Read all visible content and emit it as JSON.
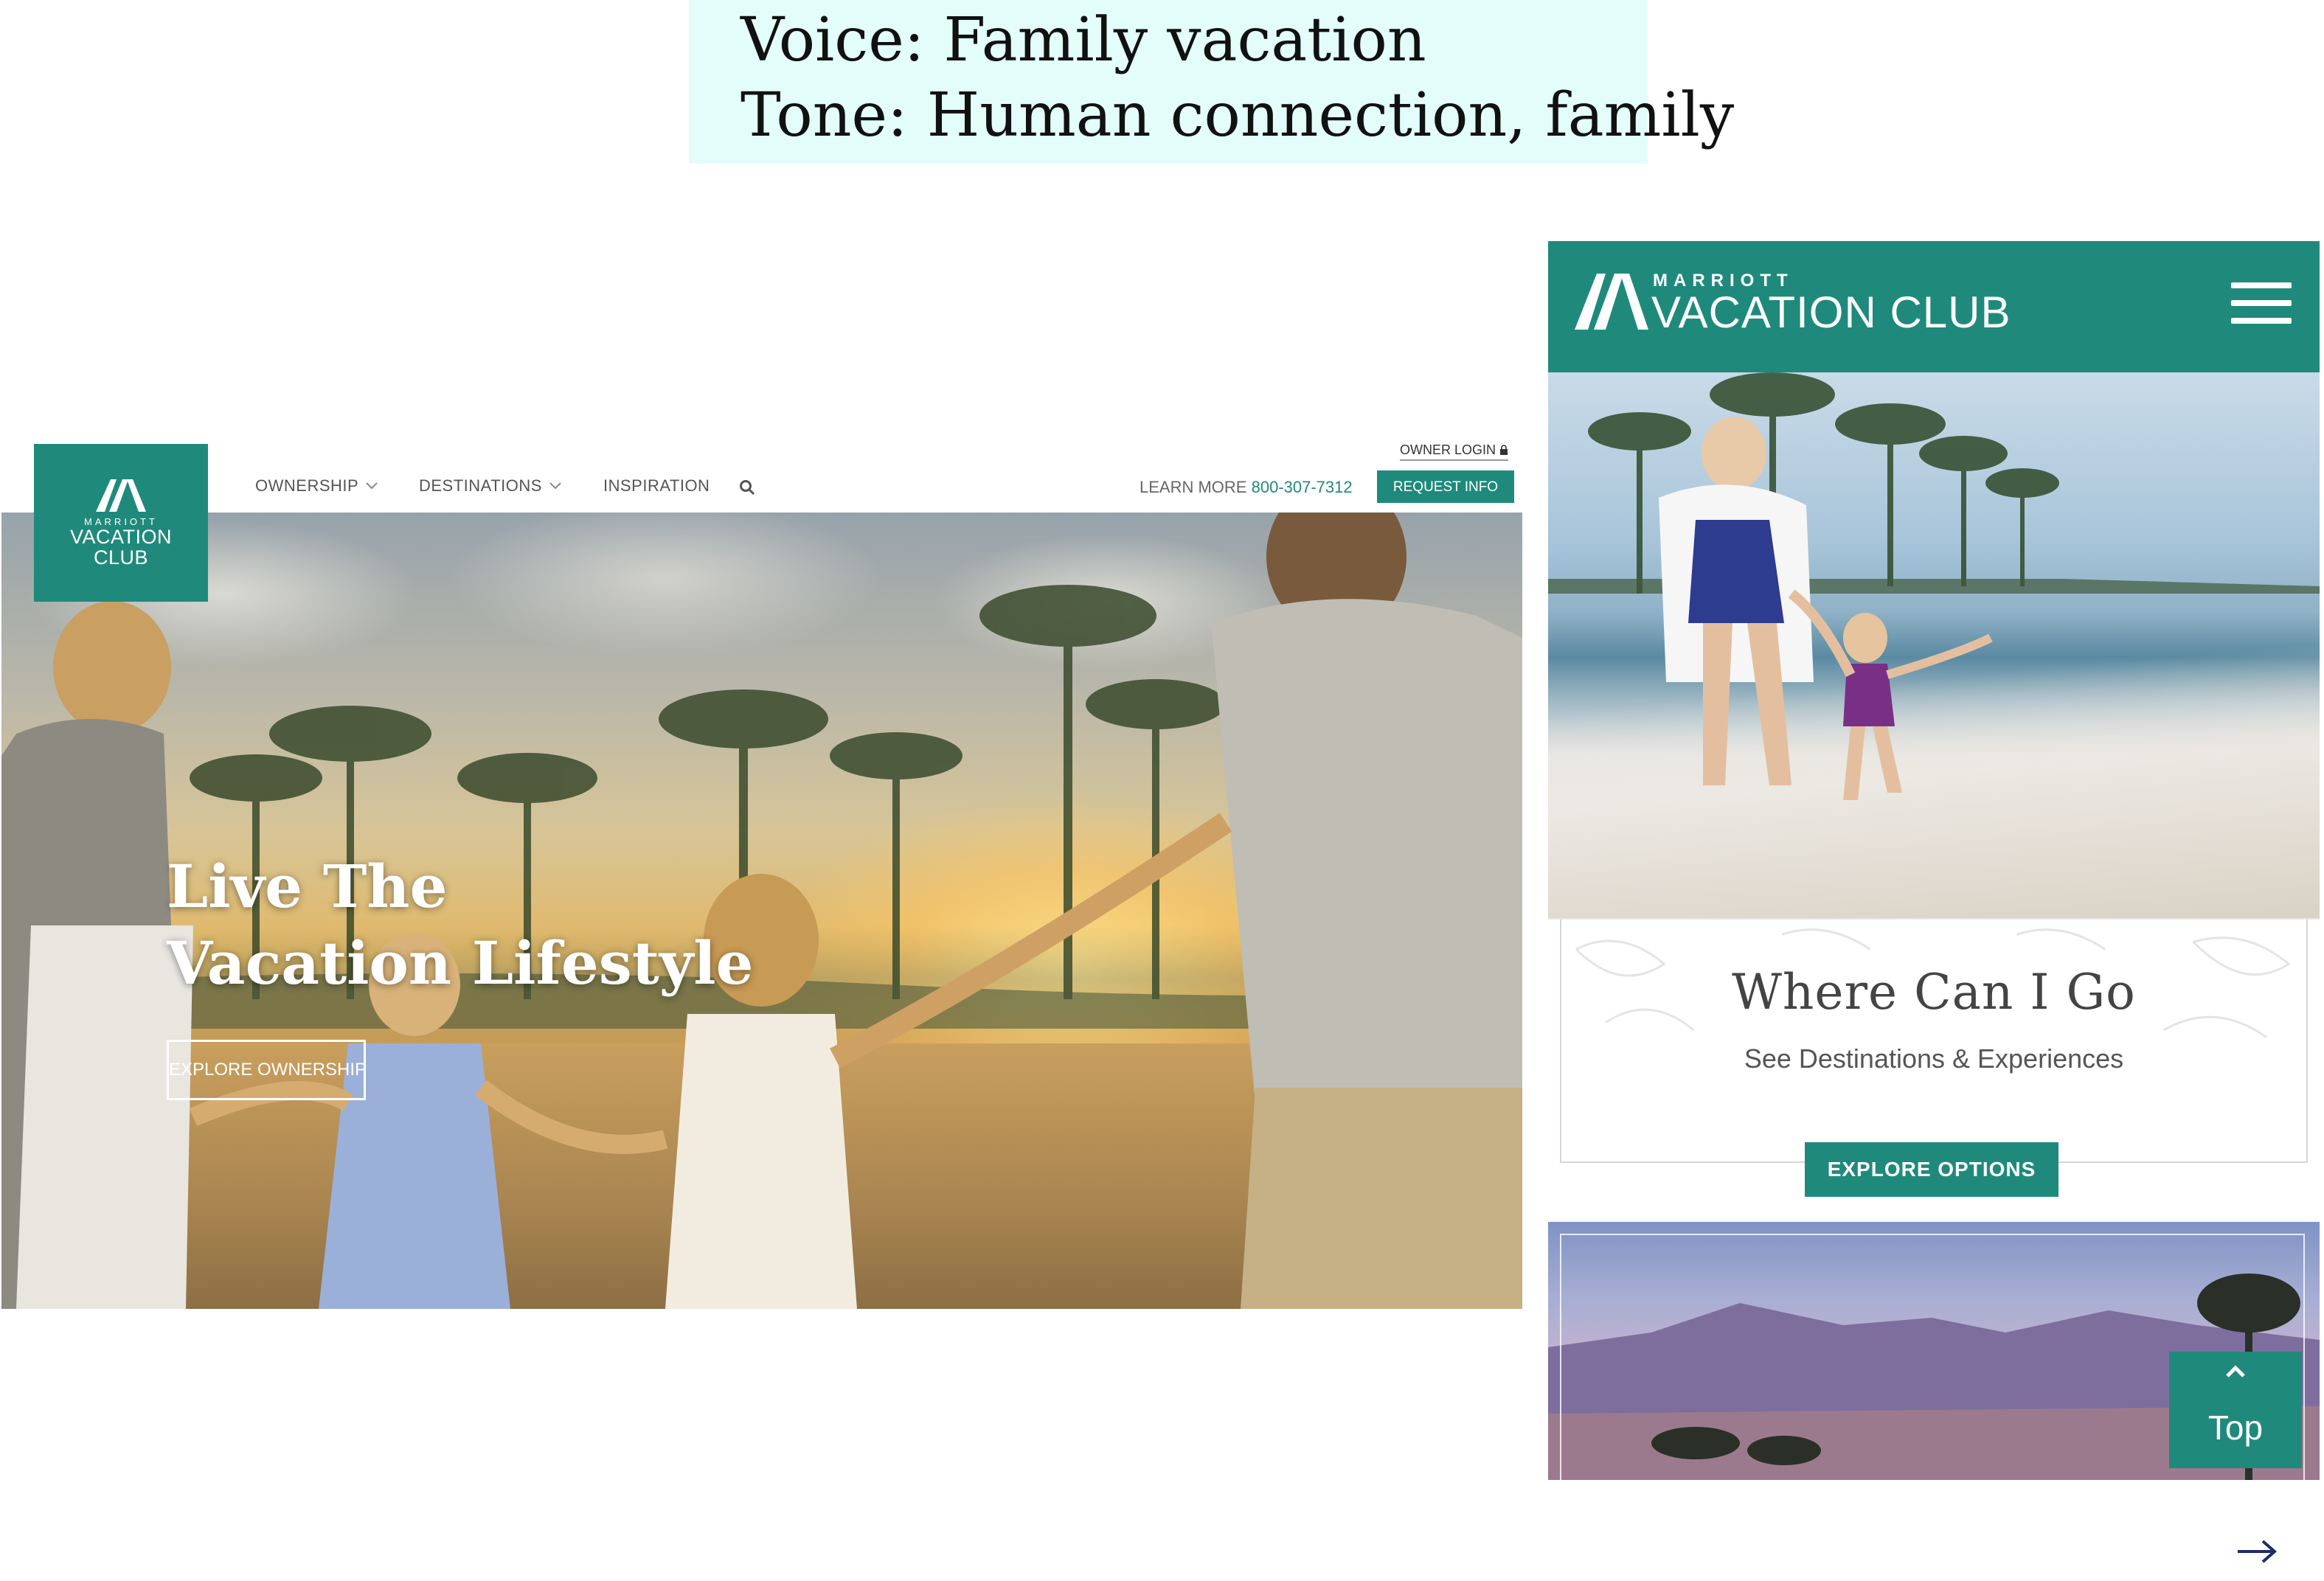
{
  "annotation": {
    "line1": "Voice: Family vacation",
    "line2": "Tone: Human connection, family"
  },
  "desktop": {
    "logo": {
      "small": "MARRIOTT",
      "big_line1": "VACATION",
      "big_line2": "CLUB"
    },
    "nav": [
      {
        "label": "OWNERSHIP",
        "has_dropdown": true
      },
      {
        "label": "DESTINATIONS",
        "has_dropdown": true
      },
      {
        "label": "INSPIRATION",
        "has_dropdown": false
      }
    ],
    "owner_login": "OWNER LOGIN",
    "learn_more": "LEARN MORE",
    "phone": "800-307-7312",
    "request_info": "REQUEST INFO",
    "hero": {
      "headline_line1": "Live The",
      "headline_line2": "Vacation Lifestyle",
      "cta": "EXPLORE OWNERSHIP"
    }
  },
  "mobile": {
    "logo": {
      "small": "MARRIOTT",
      "big": "VACATION CLUB"
    },
    "card": {
      "title": "Where Can I Go",
      "subtitle": "See Destinations & Experiences",
      "cta": "EXPLORE OPTIONS"
    },
    "top_button": "Top"
  },
  "colors": {
    "brand_teal": "#1f8a7c",
    "annotation_bg": "#e2fdfa",
    "arrow": "#1f2a6b"
  },
  "icons": [
    "marriott-m-logo-icon",
    "chevron-down-icon",
    "search-icon",
    "lock-icon",
    "hamburger-menu-icon",
    "chevron-up-icon",
    "arrow-right-icon"
  ]
}
